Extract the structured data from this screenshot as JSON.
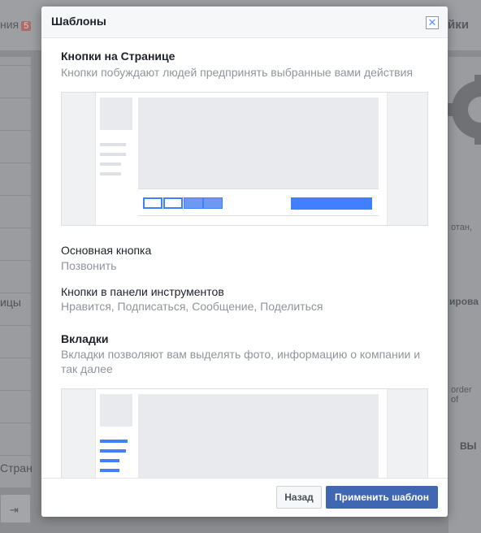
{
  "background": {
    "tab_left": "ния",
    "tab_left_badge": "5",
    "tab_right": "йки",
    "left_text_1": "ицы",
    "left_text_2": "Стран",
    "right_text_1": "отан,",
    "right_text_2": "ирова",
    "right_text_3": "order of",
    "right_text_4": "ВЫ"
  },
  "modal": {
    "title": "Шаблоны",
    "close_icon": "close-icon",
    "sections": {
      "buttons": {
        "title": "Кнопки на Странице",
        "description": "Кнопки побуждают людей предпринять выбранные вами действия"
      },
      "main_button": {
        "label": "Основная кнопка",
        "value": "Позвонить"
      },
      "toolbar_buttons": {
        "label": "Кнопки в панели инструментов",
        "value": "Нравится, Подписаться, Сообщение, Поделиться"
      },
      "tabs": {
        "title": "Вкладки",
        "description": "Вкладки позволяют вам выделять фото, информацию о компании и так далее"
      }
    },
    "footer": {
      "back_label": "Назад",
      "apply_label": "Применить шаблон"
    },
    "colors": {
      "accent": "#4267b2",
      "preview_blue": "#4080ff"
    }
  }
}
